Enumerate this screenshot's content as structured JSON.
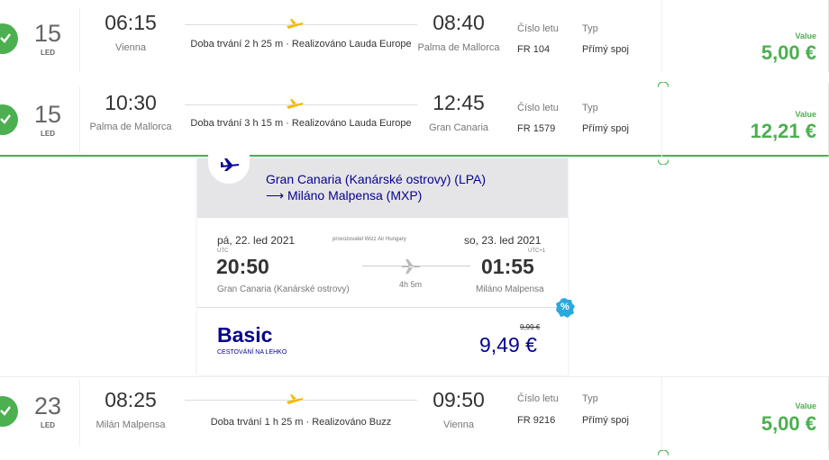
{
  "flights": [
    {
      "day": "15",
      "month": "LED",
      "dep_time": "06:15",
      "dep_city": "Vienna",
      "duration": "Doba trvání 2 h 25 m · Realizováno Lauda Europe",
      "arr_time": "08:40",
      "arr_city": "Palma de Mallorca",
      "flight_label": "Číslo letu",
      "flight_no": "FR 104",
      "type_label": "Typ",
      "type_value": "Přímý spoj",
      "value_label": "Value",
      "price": "5,00 €"
    },
    {
      "day": "15",
      "month": "LED",
      "dep_time": "10:30",
      "dep_city": "Palma de Mallorca",
      "duration": "Doba trvání 3 h 15 m · Realizováno Lauda Europe",
      "arr_time": "12:45",
      "arr_city": "Gran Canaria",
      "flight_label": "Číslo letu",
      "flight_no": "FR 1579",
      "type_label": "Typ",
      "type_value": "Přímý spoj",
      "value_label": "Value",
      "price": "12,21 €"
    },
    {
      "day": "23",
      "month": "LED",
      "dep_time": "08:25",
      "dep_city": "Milán Malpensa",
      "duration": "Doba trvání 1 h 25 m · Realizováno Buzz",
      "arr_time": "09:50",
      "arr_city": "Vienna",
      "flight_label": "Číslo letu",
      "flight_no": "FR 9216",
      "type_label": "Typ",
      "type_value": "Přímý spoj",
      "value_label": "Value",
      "price": "5,00 €"
    }
  ],
  "wizz": {
    "route_line1": "Gran Canaria (Kanárské ostrovy) (LPA)",
    "route_line2": "⟶ Miláno Malpensa (MXP)",
    "dep_date": "pá, 22. led 2021",
    "operator": "provozovatel Wizz Air Hungary",
    "arr_date": "so, 23. led 2021",
    "dep_tz": "UTC",
    "arr_tz": "UTC+1",
    "dep_time": "20:50",
    "arr_time": "01:55",
    "dep_city": "Gran Canaria (Kanárské ostrovy)",
    "arr_city": "Miláno Malpensa",
    "duration": "4h 5m",
    "fare_name": "Basic",
    "fare_sub": "CESTOVÁNÍ NA LEHKO",
    "old_price": "9,99 €",
    "price": "9,49 €",
    "badge": "%"
  },
  "colors": {
    "accent_green": "#4caf50",
    "wizz_navy": "#06038d",
    "plane_yellow": "#f5b800"
  }
}
